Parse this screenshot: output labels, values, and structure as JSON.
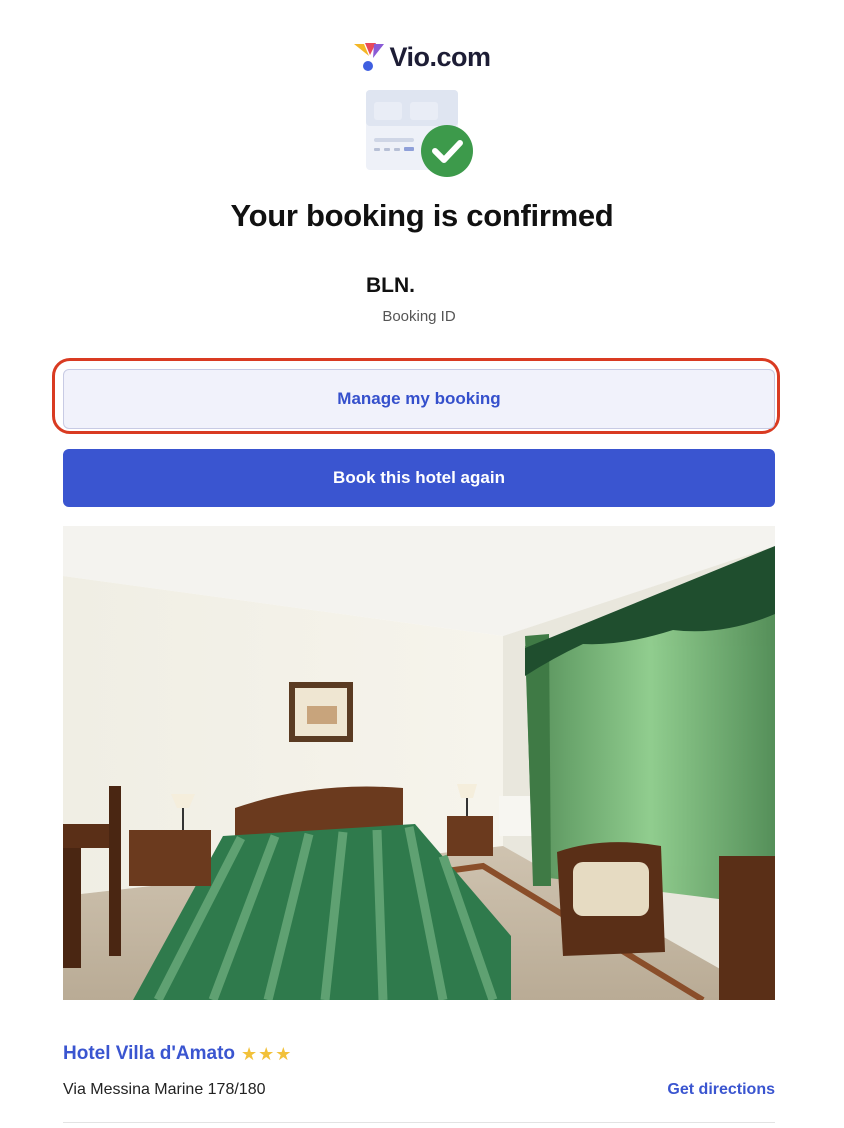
{
  "brand": {
    "name": "Vio.com",
    "colors": {
      "yellow": "#f4b726",
      "red": "#e8495a",
      "blue": "#3f5fe0",
      "text": "#1d1d35"
    }
  },
  "confirmation": {
    "title": "Your booking is confirmed",
    "booking_code": "BLN.",
    "booking_label": "Booking ID",
    "status_icon": "check-circle-icon",
    "status_color": "#3d9a4b"
  },
  "actions": {
    "manage_label": "Manage my booking",
    "book_again_label": "Book this hotel again",
    "highlight_color": "#d93b22",
    "primary_color": "#3a55d0"
  },
  "hotel": {
    "name": "Hotel Villa d'Amato",
    "stars": "★★★",
    "star_rating": 3,
    "address": "Via Messina Marine 178/180",
    "directions_label": "Get directions"
  }
}
